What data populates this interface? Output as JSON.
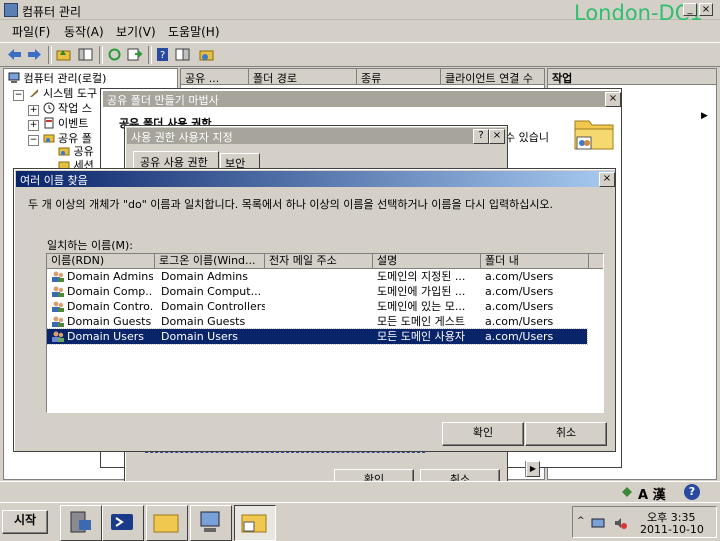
{
  "window": {
    "title": "컴퓨터 관리",
    "watermark": "London-DC1"
  },
  "menu": [
    "파일(F)",
    "동작(A)",
    "보기(V)",
    "도움말(H)"
  ],
  "tree": {
    "items": [
      "컴퓨터 관리(로컬)",
      "시스템 도구",
      "작업 스",
      "이벤트",
      "공유 폴",
      "공유",
      "세션"
    ],
    "sign_minus": "−",
    "sign_plus": "+"
  },
  "main_list": {
    "columns": [
      "공유 ...",
      "폴더 경로",
      "종류",
      "클라이언트 연결 수"
    ]
  },
  "actions": {
    "header": "작업",
    "arrow": "▶"
  },
  "wizard": {
    "title": "공유 폴더 만들기 마법사",
    "heading": "공유 폴더 사용 권한",
    "text": "수 있습니"
  },
  "perm_dialog": {
    "title": "사용 권한 사용자 지정",
    "tabs": [
      "공유 사용 권한",
      "보안"
    ],
    "ok": "확인",
    "cancel": "취소"
  },
  "multi_dialog": {
    "title": "여러 이름 찾음",
    "message": "두 개 이상의 개체가 \"do\" 이름과 일치합니다. 목록에서 하나 이상의 이름을 선택하거나 이름을 다시 입력하십시오.",
    "matches_label": "일치하는 이름(M):",
    "columns": [
      "이름(RDN)",
      "로그온 이름(Wind...",
      "전자 메일 주소",
      "설명",
      "폴더 내"
    ],
    "rows": [
      [
        "Domain Admins",
        "Domain Admins",
        "",
        "도메인의 지정된 ...",
        "a.com/Users"
      ],
      [
        "Domain Comp...",
        "Domain Comput...",
        "",
        "도메인에 가입된 ...",
        "a.com/Users"
      ],
      [
        "Domain Contro...",
        "Domain Controllers",
        "",
        "도메인에 있는 모...",
        "a.com/Users"
      ],
      [
        "Domain Guests",
        "Domain Guests",
        "",
        "모든 도메인 게스트",
        "a.com/Users"
      ],
      [
        "Domain Users",
        "Domain Users",
        "",
        "모든 도메인 사용자",
        "a.com/Users"
      ]
    ],
    "selected_row": 4,
    "ok": "확인",
    "cancel": "취소"
  },
  "taskbar": {
    "start": "시작",
    "clock_time": "오후 3:35",
    "clock_date": "2011-10-10",
    "ime": "A 漢",
    "help": "?"
  },
  "close_glyph": "×",
  "help_glyph": "?",
  "colors": {
    "selection": "#0a246a",
    "watermark": "#2fbf6f",
    "titlebar_active": "#0a246a"
  }
}
